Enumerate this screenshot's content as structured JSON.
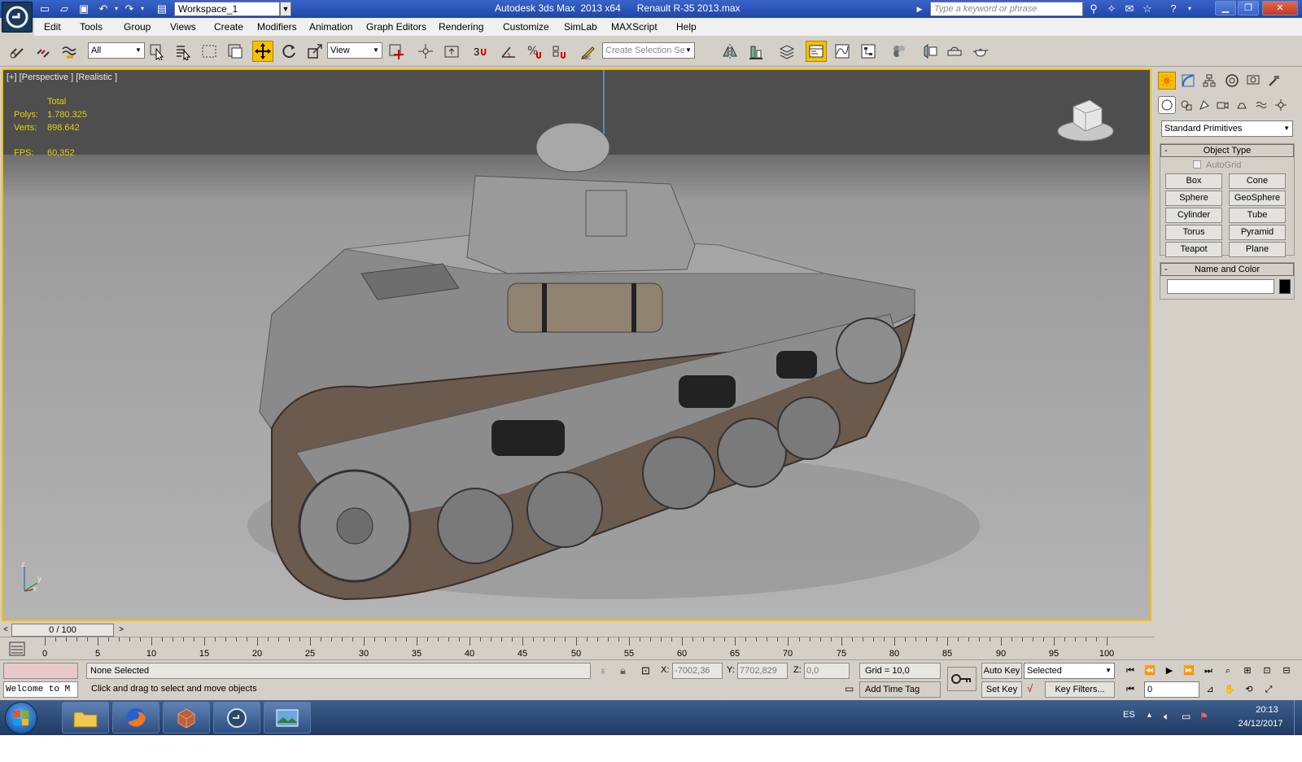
{
  "titlebar": {
    "workspace": "Workspace_1",
    "title": "Autodesk 3ds Max  2013 x64      Renault R-35 2013.max",
    "search_placeholder": "Type a keyword or phrase"
  },
  "menubar": {
    "items": [
      "Edit",
      "Tools",
      "Group",
      "Views",
      "Create",
      "Modifiers",
      "Animation",
      "Graph Editors",
      "Rendering",
      "Customize",
      "SimLab",
      "MAXScript",
      "Help"
    ]
  },
  "toolbar": {
    "selection_filter": "All",
    "ref_coord": "View",
    "snap_label": "3",
    "selection_set_placeholder": "Create Selection Se"
  },
  "viewport": {
    "label": "[+] [Perspective ] [Realistic ]",
    "stats": {
      "total_label": "Total",
      "polys_label": "Polys:",
      "polys_value": "1.780.325",
      "verts_label": "Verts:",
      "verts_value": "898.642",
      "fps_label": "FPS:",
      "fps_value": "60,352"
    },
    "axis": {
      "z": "z",
      "x": "x",
      "y": "y"
    }
  },
  "command_panel": {
    "category": "Standard Primitives",
    "object_type_title": "Object Type",
    "autogrid_label": "AutoGrid",
    "primitives": [
      "Box",
      "Cone",
      "Sphere",
      "GeoSphere",
      "Cylinder",
      "Tube",
      "Torus",
      "Pyramid",
      "Teapot",
      "Plane"
    ],
    "name_color_title": "Name and Color",
    "collapse_glyph": "-"
  },
  "timeline": {
    "frame_counter": "0 / 100",
    "prev_arrow": "<",
    "next_arrow": ">",
    "ticks": [
      "0",
      "5",
      "10",
      "15",
      "20",
      "25",
      "30",
      "35",
      "40",
      "45",
      "50",
      "55",
      "60",
      "65",
      "70",
      "75",
      "80",
      "85",
      "90",
      "95",
      "100"
    ]
  },
  "status": {
    "maxscript_text": "Welcome to M",
    "selection": "None Selected",
    "prompt": "Click and drag to select and move objects",
    "x_label": "X:",
    "x_value": "-7002,36",
    "y_label": "Y:",
    "y_value": "7702,829",
    "z_label": "Z:",
    "z_value": "0,0",
    "grid": "Grid = 10,0",
    "add_time_tag": "Add Time Tag",
    "auto_key": "Auto Key",
    "set_key": "Set Key",
    "key_mode": "Selected",
    "key_filters": "Key Filters...",
    "current_frame": "0"
  },
  "taskbar": {
    "language": "ES",
    "time": "20:13",
    "date": "24/12/2017"
  },
  "colors": {
    "accent": "#f5c000",
    "stat_text": "#e6d000",
    "titlebar": "#1f46a8"
  }
}
